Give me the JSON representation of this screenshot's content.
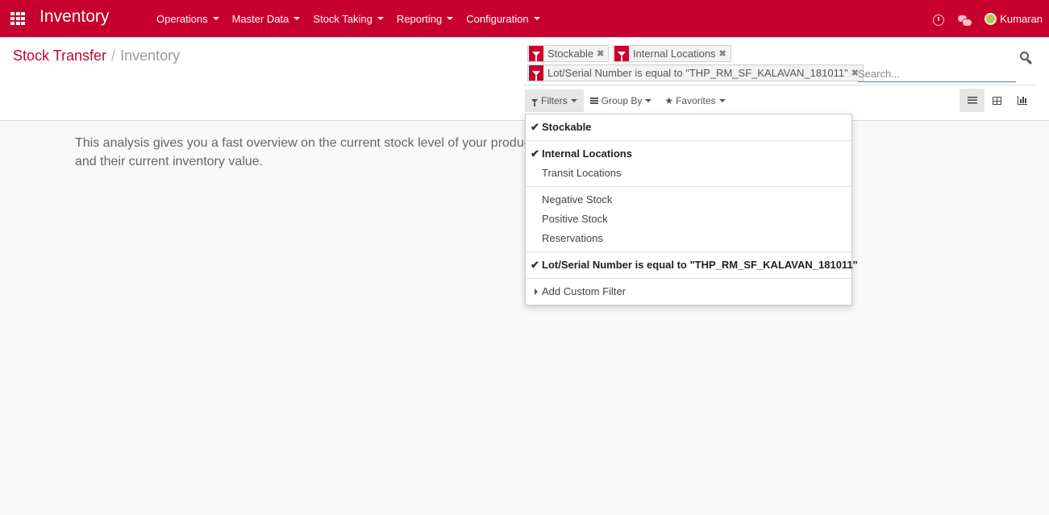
{
  "navbar": {
    "brand": "Inventory",
    "menu": [
      "Operations",
      "Master Data",
      "Stock Taking",
      "Reporting",
      "Configuration"
    ],
    "user": "Kumaran"
  },
  "breadcrumb": {
    "parent": "Stock Transfer",
    "separator": "/",
    "current": "Inventory"
  },
  "search": {
    "facets": [
      {
        "label": "Stockable",
        "remove": "✖"
      },
      {
        "label": "Internal Locations",
        "remove": "✖"
      },
      {
        "label": "Lot/Serial Number is equal to \"THP_RM_SF_KALAVAN_181011\"",
        "remove": "✖"
      }
    ],
    "placeholder": "Search..."
  },
  "filter_buttons": {
    "filters": "Filters",
    "group_by": "Group By",
    "favorites": "Favorites"
  },
  "help_text": "This analysis gives you a fast overview on the current stock level of your products and their current inventory value.",
  "dropdown": {
    "check_glyph": "✔",
    "groups": [
      [
        {
          "label": "Stockable",
          "selected": true
        }
      ],
      [
        {
          "label": "Internal Locations",
          "selected": true
        },
        {
          "label": "Transit Locations",
          "selected": false
        }
      ],
      [
        {
          "label": "Negative Stock",
          "selected": false
        },
        {
          "label": "Positive Stock",
          "selected": false
        },
        {
          "label": "Reservations",
          "selected": false
        }
      ],
      [
        {
          "label": "Lot/Serial Number is equal to \"THP_RM_SF_KALAVAN_181011\"",
          "selected": true
        }
      ],
      [
        {
          "label": "Add Custom Filter",
          "selected": false
        }
      ]
    ]
  },
  "colors": {
    "brand": "#c8002e",
    "search_underline": "#4a7fd8"
  },
  "icons": [
    "apps-icon",
    "clock-icon",
    "chat-icon",
    "search-icon",
    "filter-icon",
    "group-by-icon",
    "star-icon",
    "list-view-icon",
    "pivot-view-icon",
    "graph-view-icon",
    "check-icon",
    "caret-right-icon"
  ]
}
